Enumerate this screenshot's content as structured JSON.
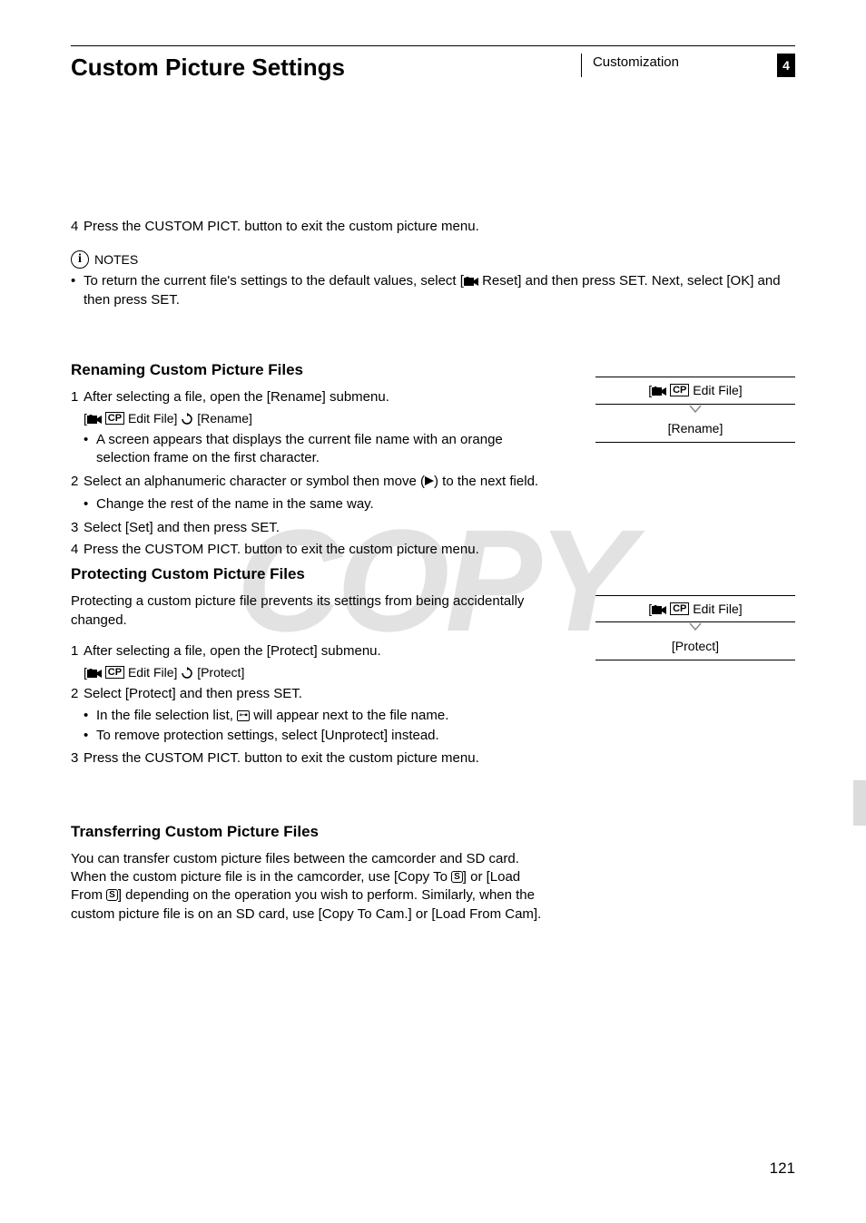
{
  "header": {
    "title": "Custom Picture Settings",
    "category": "Customization",
    "chapter": "4"
  },
  "step4a": {
    "num": "4",
    "text": "Press the CUSTOM PICT. button to exit the custom picture menu."
  },
  "notes": {
    "label": "NOTES",
    "bullet1_a": "To return the current file's settings to the default values, select [",
    "bullet1_b": " Reset] and then press SET. Next, select [OK] and then press SET."
  },
  "rename": {
    "heading": "Renaming Custom Picture Files",
    "s1": {
      "num": "1",
      "text": "After selecting a file, open the [Rename] submenu."
    },
    "path_a": "[",
    "path_b": " Edit File] ",
    "path_c": " [Rename]",
    "s1_bullet": "A screen appears that displays the current file name with an orange selection frame on the first character.",
    "s2": {
      "num": "2",
      "text_a": "Select an alphanumeric character or symbol then move (",
      "text_b": ") to the next field."
    },
    "s2_bullet": "Change the rest of the name in the same way.",
    "s3": {
      "num": "3",
      "text": "Select [Set] and then press SET."
    },
    "s4": {
      "num": "4",
      "text": "Press the CUSTOM PICT. button to exit the custom picture menu."
    }
  },
  "protect": {
    "heading": "Protecting Custom Picture Files",
    "intro": "Protecting a custom picture file prevents its settings from being accidentally changed.",
    "s1": {
      "num": "1",
      "text": "After selecting a file, open the [Protect] submenu."
    },
    "path_a": "[",
    "path_b": " Edit File] ",
    "path_c": " [Protect]",
    "s2": {
      "num": "2",
      "text": "Select [Protect] and then press SET."
    },
    "s2_bullet1_a": "In the file selection list, ",
    "s2_bullet1_b": " will appear next to the file name.",
    "s2_bullet2": "To remove protection settings, select [Unprotect] instead.",
    "s3": {
      "num": "3",
      "text": "Press the CUSTOM PICT. button to exit the custom picture menu."
    }
  },
  "transfer": {
    "heading": "Transferring Custom Picture Files",
    "p_a": "You can transfer custom picture files between the camcorder and SD card. When the custom picture file is in the camcorder, use [Copy To ",
    "p_b": "] or [Load From ",
    "p_c": "] depending on the operation you wish to perform. Similarly, when the custom picture file is on an SD card, use [Copy To Cam.] or [Load From Cam]."
  },
  "menu1": {
    "row1_a": "[",
    "row1_b": " Edit File]",
    "row2": "[Rename]"
  },
  "menu2": {
    "row1_a": "[",
    "row1_b": " Edit File]",
    "row2": "[Protect]"
  },
  "icons": {
    "cp": "CP",
    "sd": "✇",
    "lock": "⊶"
  },
  "pageNumber": "121",
  "watermark": "COPY"
}
